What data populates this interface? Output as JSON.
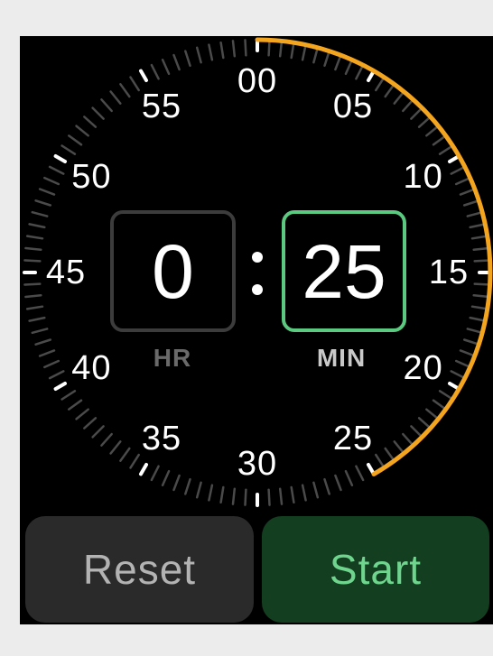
{
  "dial": {
    "labels": [
      "00",
      "05",
      "10",
      "15",
      "20",
      "25",
      "30",
      "35",
      "40",
      "45",
      "50",
      "55"
    ],
    "progress_color": "#f3a51f",
    "selected_minutes": 25
  },
  "timer": {
    "hours_value": "0",
    "separator": ":",
    "minutes_value": "25",
    "hours_unit": "HR",
    "minutes_unit": "MIN"
  },
  "buttons": {
    "reset_label": "Reset",
    "start_label": "Start"
  },
  "colors": {
    "accent_green": "#5bc980",
    "start_background": "#133e20",
    "reset_background": "#2a2a2a"
  }
}
